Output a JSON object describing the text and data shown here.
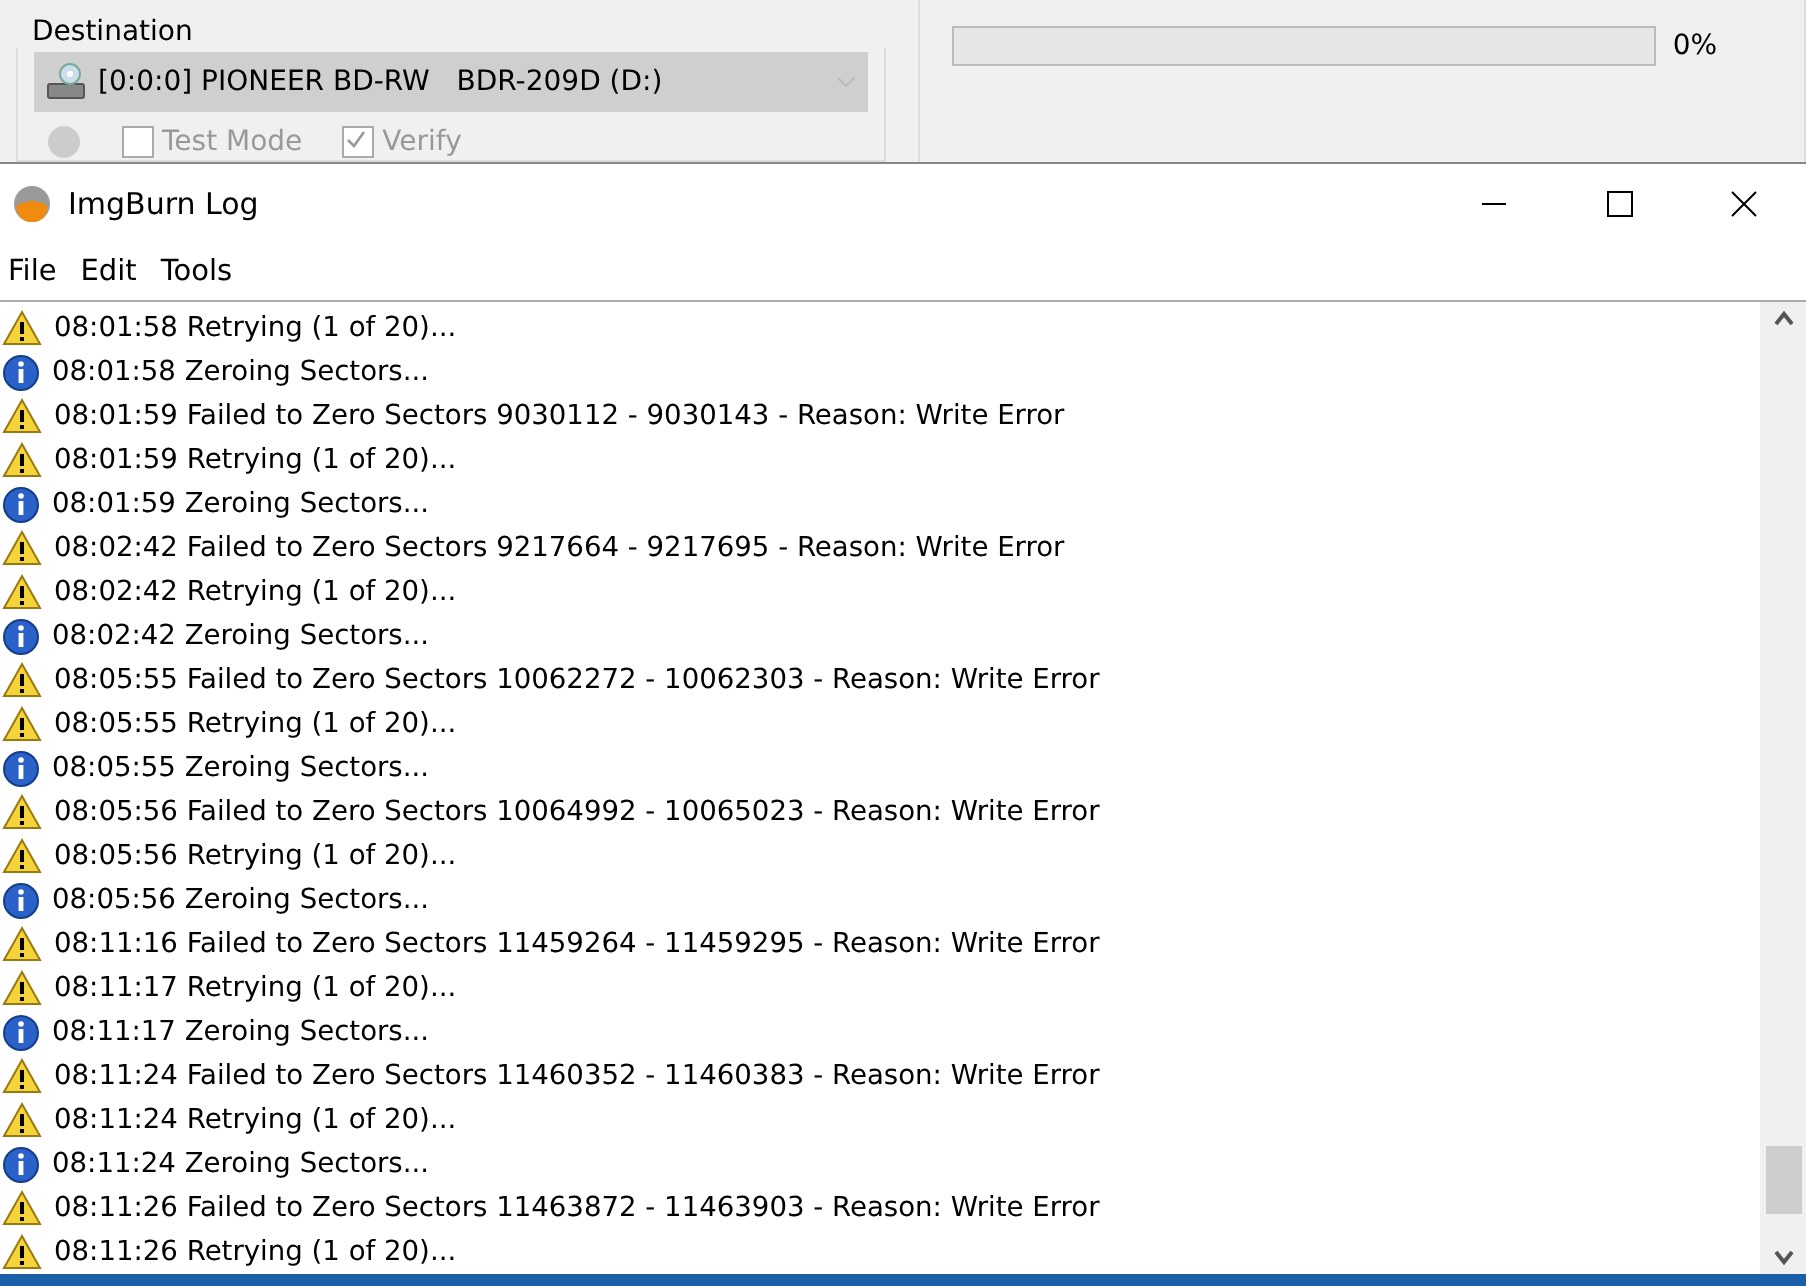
{
  "background_window": {
    "destination": {
      "label": "Destination",
      "drive": "[0:0:0] PIONEER BD-RW   BDR-209D (D:)"
    },
    "options": [
      {
        "label": "Test Mode",
        "checked": false
      },
      {
        "label": "Verify",
        "checked": true
      }
    ],
    "progress": {
      "level": 0,
      "reading": "0%"
    }
  },
  "window": {
    "title": "ImgBurn Log"
  },
  "menu": [
    "File",
    "Edit",
    "Tools"
  ],
  "log": [
    {
      "kind": "warning",
      "text": "08:01:58 Retrying (1 of 20)..."
    },
    {
      "kind": "info",
      "text": "08:01:58 Zeroing Sectors..."
    },
    {
      "kind": "warning",
      "text": "08:01:59 Failed to Zero Sectors 9030112 - 9030143 - Reason: Write Error"
    },
    {
      "kind": "warning",
      "text": "08:01:59 Retrying (1 of 20)..."
    },
    {
      "kind": "info",
      "text": "08:01:59 Zeroing Sectors..."
    },
    {
      "kind": "warning",
      "text": "08:02:42 Failed to Zero Sectors 9217664 - 9217695 - Reason: Write Error"
    },
    {
      "kind": "warning",
      "text": "08:02:42 Retrying (1 of 20)..."
    },
    {
      "kind": "info",
      "text": "08:02:42 Zeroing Sectors..."
    },
    {
      "kind": "warning",
      "text": "08:05:55 Failed to Zero Sectors 10062272 - 10062303 - Reason: Write Error"
    },
    {
      "kind": "warning",
      "text": "08:05:55 Retrying (1 of 20)..."
    },
    {
      "kind": "info",
      "text": "08:05:55 Zeroing Sectors..."
    },
    {
      "kind": "warning",
      "text": "08:05:56 Failed to Zero Sectors 10064992 - 10065023 - Reason: Write Error"
    },
    {
      "kind": "warning",
      "text": "08:05:56 Retrying (1 of 20)..."
    },
    {
      "kind": "info",
      "text": "08:05:56 Zeroing Sectors..."
    },
    {
      "kind": "warning",
      "text": "08:11:16 Failed to Zero Sectors 11459264 - 11459295 - Reason: Write Error"
    },
    {
      "kind": "warning",
      "text": "08:11:17 Retrying (1 of 20)..."
    },
    {
      "kind": "info",
      "text": "08:11:17 Zeroing Sectors..."
    },
    {
      "kind": "warning",
      "text": "08:11:24 Failed to Zero Sectors 11460352 - 11460383 - Reason: Write Error"
    },
    {
      "kind": "warning",
      "text": "08:11:24 Retrying (1 of 20)..."
    },
    {
      "kind": "info",
      "text": "08:11:24 Zeroing Sectors..."
    },
    {
      "kind": "warning",
      "text": "08:11:26 Failed to Zero Sectors 11463872 - 11463903 - Reason: Write Error"
    },
    {
      "kind": "warning",
      "text": "08:11:26 Retrying (1 of 20)..."
    }
  ]
}
